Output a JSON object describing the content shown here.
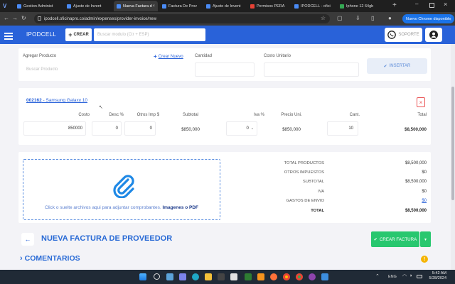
{
  "browser": {
    "tabs": [
      {
        "title": "Gestion Administ"
      },
      {
        "title": "Ajuste de Invent"
      },
      {
        "title": "Nueva Factura d"
      },
      {
        "title": "Factura De Prov"
      },
      {
        "title": "Ajuste de Invent"
      },
      {
        "title": "Permisos PERA"
      },
      {
        "title": "IPODCELL - ofici"
      },
      {
        "title": "Iphone 12 64gb"
      }
    ],
    "url": "ipodcell.oficinapro.co/admin/expenses/provider-invoice/new",
    "chrome_badge": "Nuevo Chrome disponible"
  },
  "header": {
    "brand": "IPODCELL",
    "crear_label": "CREAR",
    "search_placeholder": "Buscar modulo (Ctr + ESP)",
    "soporte_label": "SOPORTE"
  },
  "add_product": {
    "producto_label": "Agregar Producto",
    "crear_nuevo_label": "Crear Nuevo",
    "producto_placeholder": "Buscar Producto",
    "cantidad_label": "Cantidad",
    "costo_label": "Costo Unitario",
    "insertar_label": "INSERTAR"
  },
  "line_item": {
    "product_code": "002162",
    "product_name": " - Samsung Galaxy 10",
    "headers": {
      "costo": "Costo",
      "desc": "Desc %",
      "otros": "Otros Imp $",
      "subtotal": "Subtotal",
      "iva": "Iva %",
      "precio": "Precio Uni.",
      "cant": "Cant.",
      "total": "Total"
    },
    "costo": "850000",
    "desc": "0",
    "otros": "0",
    "subtotal": "$850,000",
    "iva": "0",
    "precio": "$850,000",
    "cant": "10",
    "total": "$8,500,000"
  },
  "upload": {
    "text": "Click o suelte archivos aqui para adjuntar comprobantes.",
    "types": "Imagenes o PDF"
  },
  "totals": [
    {
      "label": "TOTAL PRODUCTOS",
      "value": "$8,500,000"
    },
    {
      "label": "OTROS IMPUESTOS",
      "value": "$0"
    },
    {
      "label": "SUBTOTAL",
      "value": "$8,500,000"
    },
    {
      "label": "IVA",
      "value": "$0"
    },
    {
      "label": "GASTOS DE ENVIO",
      "value": "$0"
    },
    {
      "label": "TOTAL",
      "value": "$8,500,000"
    }
  ],
  "footer": {
    "page_title": "NUEVA FACTURA DE PROVEEDOR",
    "crear_factura_label": "CREAR FACTURA",
    "comentarios_label": "COMENTARIOS"
  },
  "taskbar": {
    "lang": "ENG",
    "time": "5:42 AM",
    "date": "5/28/2024"
  },
  "colors": {
    "primary": "#2962d9",
    "success": "#28c76f",
    "danger": "#ea5455",
    "accent": "#1e88e5"
  }
}
